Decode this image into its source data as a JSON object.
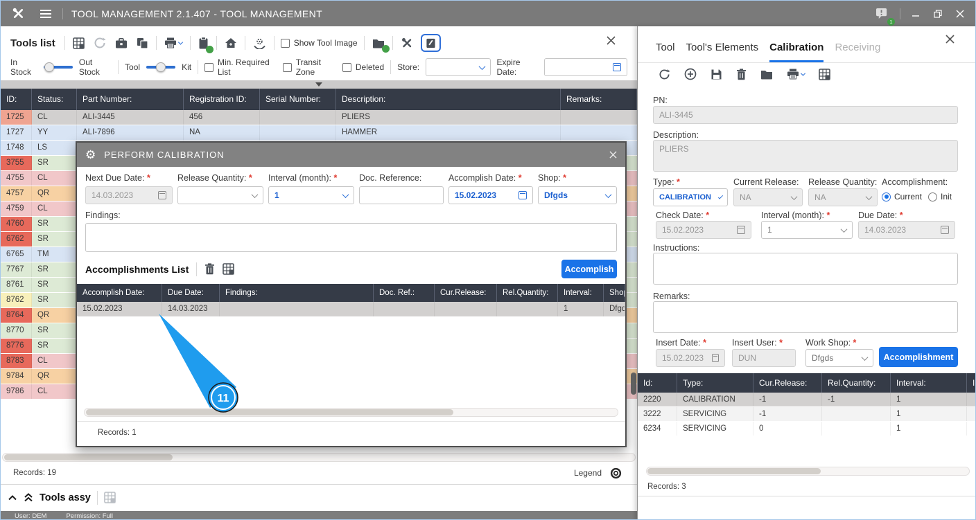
{
  "colors": {
    "accent_blue": "#1a73e8",
    "arrow_blue": "#1f9cee",
    "titlebar_gray": "#7a7a7a",
    "table_header_dark": "#353b47",
    "selected_row_gray": "#d2d0cf",
    "status_green": "#ddead5",
    "status_pink": "#f1c7c9",
    "status_orange": "#f7d1a3",
    "status_blue": "#d8e4f4",
    "alert_red": "#e7695b",
    "alert_salmon": "#efa491",
    "alert_yellow": "#f8f0bb",
    "badge_green": "#43a047",
    "required_red": "#e03c31"
  },
  "titlebar": {
    "title": "TOOL MANAGEMENT 2.1.407 - TOOL MANAGEMENT",
    "notification_badge": "1"
  },
  "statusbar": {
    "user": "User: DEM",
    "permission": "Permission: Full"
  },
  "tools_list": {
    "title": "Tools list",
    "toolbar": {
      "show_tool_image": "Show Tool Image"
    },
    "filters": {
      "in_stock": "In Stock",
      "out_stock": "Out Stock",
      "tool": "Tool",
      "kit": "Kit",
      "min_required_list": "Min. Required List",
      "transit_zone": "Transit Zone",
      "deleted": "Deleted",
      "store_label": "Store:",
      "store_value": "",
      "expire_date_label": "Expire Date:",
      "expire_date_value": ""
    },
    "table": {
      "columns": [
        "ID:",
        "Status:",
        "Part Number:",
        "Registration ID:",
        "Serial Number:",
        "Description:",
        "Remarks:"
      ],
      "rows": [
        {
          "id": "1725",
          "status": "CL",
          "part_number": "ALI-3445",
          "registration_id": "456",
          "serial_number": "",
          "description": "PLIERS",
          "remarks": "",
          "id_color": "#efa491",
          "row_color": "#d2d0cf",
          "selected": true
        },
        {
          "id": "1727",
          "status": "YY",
          "part_number": "ALI-7896",
          "registration_id": "NA",
          "serial_number": "",
          "description": "HAMMER",
          "remarks": "",
          "id_color": "#d8e4f4",
          "row_color": "#d8e4f4",
          "selected": false
        },
        {
          "id": "1748",
          "status": "LS",
          "part_number": "",
          "registration_id": "",
          "serial_number": "",
          "description": "",
          "remarks": "",
          "id_color": "#d8e4f4",
          "row_color": "#d8e4f4",
          "selected": false
        },
        {
          "id": "3755",
          "status": "SR",
          "part_number": "",
          "registration_id": "",
          "serial_number": "",
          "description": "",
          "remarks": "",
          "id_color": "#e7695b",
          "row_color": "#ddead5",
          "selected": false
        },
        {
          "id": "4755",
          "status": "CL",
          "part_number": "",
          "registration_id": "",
          "serial_number": "",
          "description": "",
          "remarks": "",
          "id_color": "#f1c7c9",
          "row_color": "#f1c7c9",
          "selected": false
        },
        {
          "id": "4757",
          "status": "QR",
          "part_number": "",
          "registration_id": "",
          "serial_number": "",
          "description": "",
          "remarks": "",
          "id_color": "#f7d1a3",
          "row_color": "#f7d1a3",
          "selected": false
        },
        {
          "id": "4759",
          "status": "CL",
          "part_number": "",
          "registration_id": "",
          "serial_number": "",
          "description": "",
          "remarks": "",
          "id_color": "#f1c7c9",
          "row_color": "#f1c7c9",
          "selected": false
        },
        {
          "id": "4760",
          "status": "SR",
          "part_number": "",
          "registration_id": "",
          "serial_number": "",
          "description": "",
          "remarks": "",
          "id_color": "#e7695b",
          "row_color": "#ddead5",
          "selected": false
        },
        {
          "id": "6762",
          "status": "SR",
          "part_number": "",
          "registration_id": "",
          "serial_number": "",
          "description": "",
          "remarks": "",
          "id_color": "#e7695b",
          "row_color": "#ddead5",
          "selected": false
        },
        {
          "id": "6765",
          "status": "TM",
          "part_number": "",
          "registration_id": "",
          "serial_number": "",
          "description": "",
          "remarks": "",
          "id_color": "#d8e4f4",
          "row_color": "#d8e4f4",
          "selected": false
        },
        {
          "id": "7767",
          "status": "SR",
          "part_number": "",
          "registration_id": "",
          "serial_number": "",
          "description": "",
          "remarks": "",
          "id_color": "#ddead5",
          "row_color": "#ddead5",
          "selected": false
        },
        {
          "id": "8761",
          "status": "SR",
          "part_number": "",
          "registration_id": "",
          "serial_number": "",
          "description": "",
          "remarks": "",
          "id_color": "#ddead5",
          "row_color": "#ddead5",
          "selected": false
        },
        {
          "id": "8762",
          "status": "SR",
          "part_number": "",
          "registration_id": "",
          "serial_number": "",
          "description": "",
          "remarks": "",
          "id_color": "#f8f0bb",
          "row_color": "#ddead5",
          "selected": false
        },
        {
          "id": "8764",
          "status": "QR",
          "part_number": "",
          "registration_id": "",
          "serial_number": "",
          "description": "",
          "remarks": "",
          "id_color": "#e7695b",
          "row_color": "#f7d1a3",
          "selected": false
        },
        {
          "id": "8770",
          "status": "SR",
          "part_number": "",
          "registration_id": "",
          "serial_number": "",
          "description": "",
          "remarks": "",
          "id_color": "#ddead5",
          "row_color": "#ddead5",
          "selected": false
        },
        {
          "id": "8776",
          "status": "SR",
          "part_number": "",
          "registration_id": "",
          "serial_number": "",
          "description": "",
          "remarks": "",
          "id_color": "#e7695b",
          "row_color": "#ddead5",
          "selected": false
        },
        {
          "id": "8783",
          "status": "CL",
          "part_number": "",
          "registration_id": "",
          "serial_number": "",
          "description": "",
          "remarks": "",
          "id_color": "#e7695b",
          "row_color": "#f1c7c9",
          "selected": false
        },
        {
          "id": "9784",
          "status": "QR",
          "part_number": "",
          "registration_id": "",
          "serial_number": "",
          "description": "",
          "remarks": "",
          "id_color": "#f7d1a3",
          "row_color": "#f7d1a3",
          "selected": false
        },
        {
          "id": "9786",
          "status": "CL",
          "part_number": "",
          "registration_id": "",
          "serial_number": "",
          "description": "",
          "remarks": "",
          "id_color": "#f1c7c9",
          "row_color": "#f1c7c9",
          "selected": false
        }
      ]
    },
    "records": "Records: 19",
    "legend": "Legend",
    "tools_assy": "Tools assy"
  },
  "modal": {
    "title": "PERFORM CALIBRATION",
    "fields": {
      "next_due_date": {
        "label": "Next Due Date:",
        "value": "14.03.2023"
      },
      "release_quantity": {
        "label": "Release Quantity:",
        "value": ""
      },
      "interval": {
        "label": "Interval (month):",
        "value": "1"
      },
      "doc_reference": {
        "label": "Doc. Reference:",
        "value": ""
      },
      "accomplish_date": {
        "label": "Accomplish Date:",
        "value": "15.02.2023"
      },
      "shop": {
        "label": "Shop:",
        "value": "Dfgds"
      }
    },
    "findings_label": "Findings:",
    "findings_value": "",
    "accomplishments": {
      "title": "Accomplishments List",
      "accomplish_button": "Accomplish",
      "columns": [
        "Accomplish Date:",
        "Due Date:",
        "Findings:",
        "Doc. Ref.:",
        "Cur.Release:",
        "Rel.Quantity:",
        "Interval:",
        "Shop:"
      ],
      "rows": [
        [
          "15.02.2023",
          "14.03.2023",
          "",
          "",
          "",
          "",
          "1",
          "Dfgds"
        ]
      ],
      "records": "Records: 1"
    },
    "annotation_badge": "11"
  },
  "right_panel": {
    "tabs": [
      "Tool",
      "Tool's Elements",
      "Calibration",
      "Receiving"
    ],
    "active_tab": "Calibration",
    "form": {
      "pn_label": "PN:",
      "pn_value": "ALI-3445",
      "description_label": "Description:",
      "description_value": "PLIERS",
      "type_label": "Type:",
      "type_value": "CALIBRATION",
      "current_release_label": "Current Release:",
      "current_release_value": "NA",
      "release_quantity_label": "Release Quantity:",
      "release_quantity_value": "NA",
      "accomplishment_label": "Accomplishment:",
      "radio_current": "Current",
      "radio_init": "Init",
      "check_date_label": "Check Date:",
      "check_date_value": "15.02.2023",
      "interval_label": "Interval (month):",
      "interval_value": "1",
      "due_date_label": "Due Date:",
      "due_date_value": "14.03.2023",
      "instructions_label": "Instructions:",
      "instructions_value": "",
      "remarks_label": "Remarks:",
      "remarks_value": "",
      "insert_date_label": "Insert Date:",
      "insert_date_value": "15.02.2023",
      "insert_user_label": "Insert User:",
      "insert_user_value": "DUN",
      "work_shop_label": "Work Shop:",
      "work_shop_value": "Dfgds",
      "accomplishment_button": "Accomplishment"
    },
    "table": {
      "columns": [
        "Id:",
        "Type:",
        "Cur.Release:",
        "Rel.Quantity:",
        "Interval:",
        "In"
      ],
      "rows": [
        {
          "id": "2220",
          "type": "CALIBRATION",
          "cur_release": "-1",
          "rel_quantity": "-1",
          "interval": "1",
          "selected": true
        },
        {
          "id": "3222",
          "type": "SERVICING",
          "cur_release": "-1",
          "rel_quantity": "",
          "interval": "1",
          "selected": false
        },
        {
          "id": "6234",
          "type": "SERVICING",
          "cur_release": "0",
          "rel_quantity": "",
          "interval": "1",
          "selected": false
        }
      ],
      "records": "Records: 3"
    }
  }
}
